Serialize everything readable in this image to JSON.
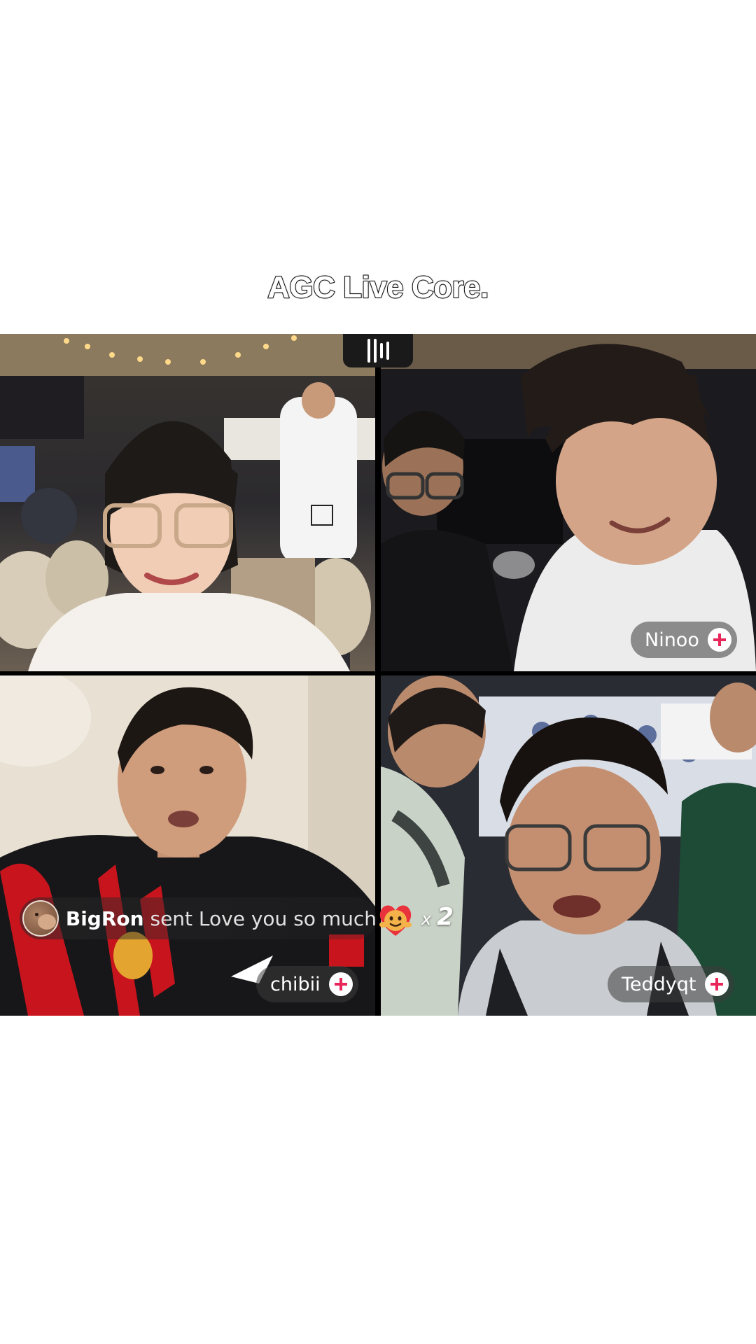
{
  "caption": "AGC Live Core.",
  "tiles": [
    {
      "name": ""
    },
    {
      "name": "Ninoo"
    },
    {
      "name": "chibii"
    },
    {
      "name": "Teddyqt"
    }
  ],
  "gift": {
    "user": "BigRon",
    "message": "sent Love you so much",
    "count_prefix": "x",
    "count": "2",
    "icon": "love-you-so-much-gift-icon"
  },
  "icons": {
    "live": "live-audio-bars-icon",
    "follow": "plus-icon"
  },
  "colors": {
    "follow_plus": "#e8265a",
    "pill_background": "#3c3c3c"
  }
}
